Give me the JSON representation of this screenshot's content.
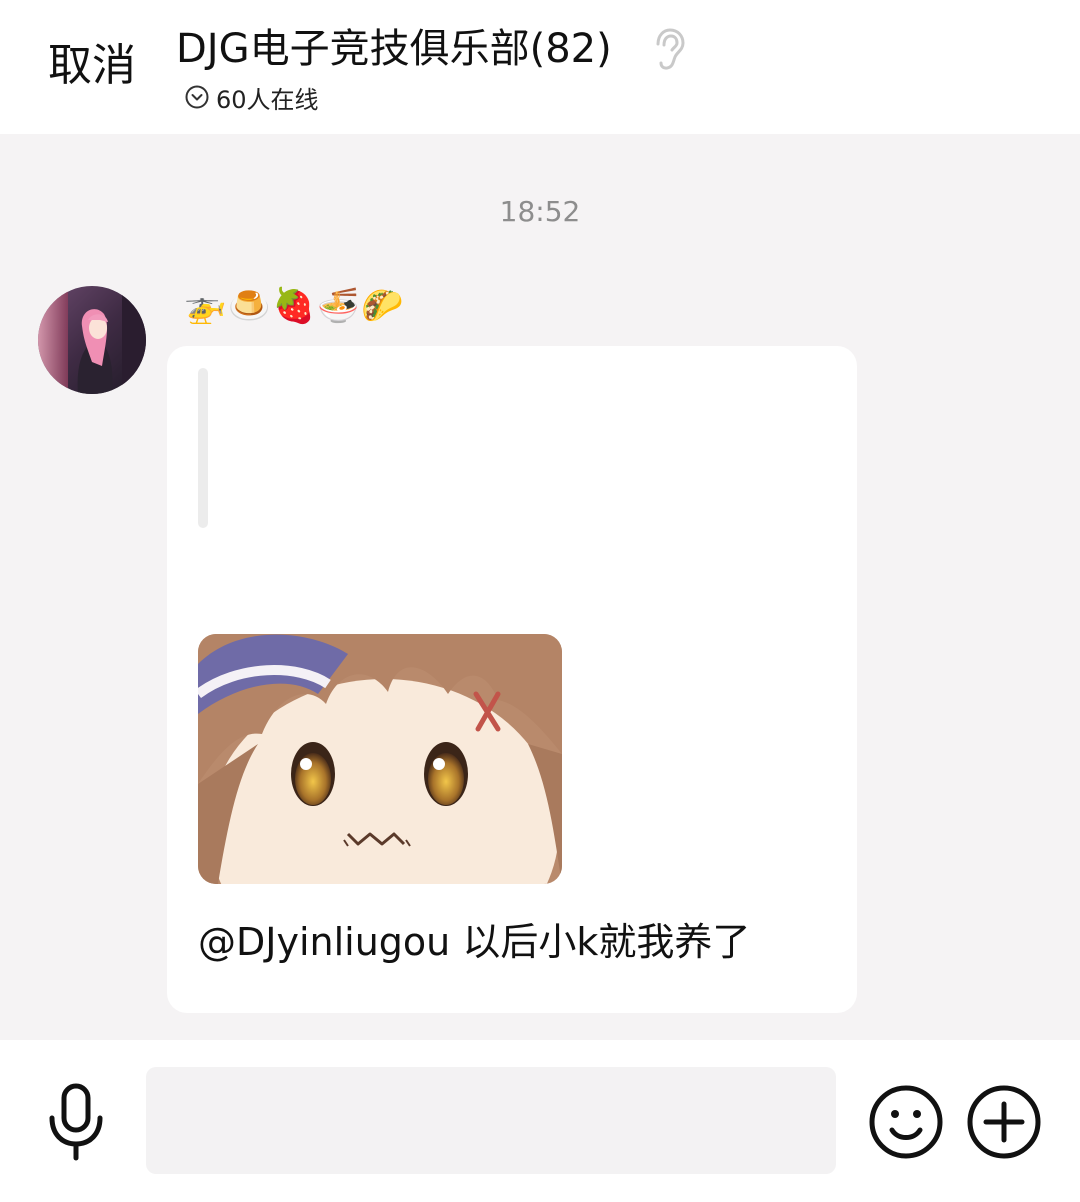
{
  "header": {
    "cancel_label": "取消",
    "title": "DJG电子竞技俱乐部(82)",
    "online": "60人在线",
    "icons": {
      "listen": "ear-icon",
      "online": "chevron-down-circle-icon"
    }
  },
  "chat": {
    "timestamp": "18:52",
    "message": {
      "nickname": "🚁🍮🍓🍜🌮",
      "text": "@DJyinliugou 以后小k就我养了",
      "has_quote": true,
      "has_sticker": true
    }
  },
  "input_bar": {
    "placeholder": "",
    "icons": [
      "microphone-icon",
      "smiley-icon",
      "plus-icon"
    ]
  },
  "colors": {
    "background": "#f5f3f4",
    "bubble": "#ffffff",
    "timestamp": "#8d8d8d",
    "input_field": "#f3f2f3"
  }
}
